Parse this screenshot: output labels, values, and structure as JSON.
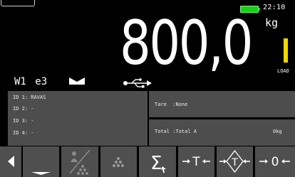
{
  "status": {
    "clock": "22:10",
    "battery_color": "#19d019"
  },
  "display": {
    "weight": "800,0",
    "unit": "kg",
    "load_label": "LOAD",
    "load_color": "#f2d600",
    "range_label": "W1 e3",
    "net_icon": "net-zero-icon",
    "usb_icon": "usb-icon"
  },
  "ids": [
    "ID 1: RAVAS",
    "ID 2: -",
    "ID 3: -",
    "ID 4: -"
  ],
  "tare": {
    "label": "Tare  :None"
  },
  "total": {
    "label": "Total :Total A",
    "value": "0kg"
  },
  "softkeys": [
    {
      "icon": "arrow-left-icon"
    },
    {
      "icon": "minimize-icon"
    },
    {
      "icon": "piece-count-disabled-icon"
    },
    {
      "icon": "piece-count-icon"
    },
    {
      "icon": "sum-icon"
    },
    {
      "icon": "tare-icon",
      "text": "T"
    },
    {
      "icon": "preset-tare-icon",
      "text": "T"
    },
    {
      "icon": "zero-icon",
      "text": "0"
    }
  ]
}
